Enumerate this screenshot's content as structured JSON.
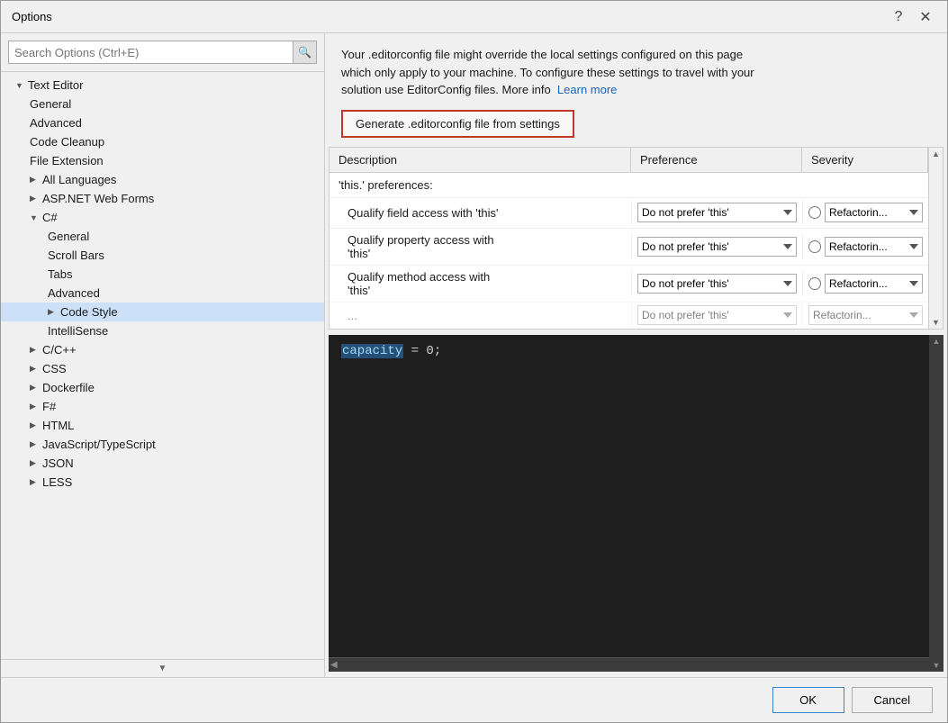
{
  "dialog": {
    "title": "Options",
    "help_btn": "?",
    "close_btn": "✕"
  },
  "search": {
    "placeholder": "Search Options (Ctrl+E)"
  },
  "tree": {
    "items": [
      {
        "id": "text-editor",
        "label": "Text Editor",
        "level": "root",
        "expanded": true,
        "indent": 16
      },
      {
        "id": "general",
        "label": "General",
        "level": "level1",
        "indent": 32
      },
      {
        "id": "advanced",
        "label": "Advanced",
        "level": "level1",
        "indent": 32
      },
      {
        "id": "code-cleanup",
        "label": "Code Cleanup",
        "level": "level1",
        "indent": 32
      },
      {
        "id": "file-extension",
        "label": "File Extension",
        "level": "level1",
        "indent": 32
      },
      {
        "id": "all-languages",
        "label": "All Languages",
        "level": "level1-expand",
        "indent": 32
      },
      {
        "id": "aspnet",
        "label": "ASP.NET Web Forms",
        "level": "level1-expand",
        "indent": 32
      },
      {
        "id": "csharp",
        "label": "C#",
        "level": "level1-open",
        "indent": 32
      },
      {
        "id": "csharp-general",
        "label": "General",
        "level": "level2",
        "indent": 48
      },
      {
        "id": "scroll-bars",
        "label": "Scroll Bars",
        "level": "level2",
        "indent": 48
      },
      {
        "id": "tabs",
        "label": "Tabs",
        "level": "level2",
        "indent": 48
      },
      {
        "id": "csharp-advanced",
        "label": "Advanced",
        "level": "level2",
        "indent": 48
      },
      {
        "id": "code-style",
        "label": "Code Style",
        "level": "level2-open",
        "indent": 48,
        "selected": true
      },
      {
        "id": "intellisense",
        "label": "IntelliSense",
        "level": "level2",
        "indent": 48
      },
      {
        "id": "cpp",
        "label": "C/C++",
        "level": "level1-expand",
        "indent": 32
      },
      {
        "id": "css",
        "label": "CSS",
        "level": "level1-expand",
        "indent": 32
      },
      {
        "id": "dockerfile",
        "label": "Dockerfile",
        "level": "level1-expand",
        "indent": 32
      },
      {
        "id": "fsharp",
        "label": "F#",
        "level": "level1-expand",
        "indent": 32
      },
      {
        "id": "html",
        "label": "HTML",
        "level": "level1-expand",
        "indent": 32
      },
      {
        "id": "javascript",
        "label": "JavaScript/TypeScript",
        "level": "level1-expand",
        "indent": 32
      },
      {
        "id": "json",
        "label": "JSON",
        "level": "level1-expand",
        "indent": 32
      },
      {
        "id": "less",
        "label": "LESS",
        "level": "level1-expand",
        "indent": 32
      }
    ]
  },
  "notice": {
    "text1": "Your .editorconfig file might override the local settings configured on this page",
    "text2": "which only apply to your machine. To configure these settings to travel with your",
    "text3": "solution use EditorConfig files. More info",
    "link": "Learn more"
  },
  "generate_btn": "Generate .editorconfig file from settings",
  "table": {
    "headers": [
      "Description",
      "Preference",
      "Severity"
    ],
    "section_label": "'this.' preferences:",
    "rows": [
      {
        "desc": "Qualify field access with 'this'",
        "pref": "Do not prefer 'this'",
        "sev": "Refactorin..."
      },
      {
        "desc": "Qualify property access with\n'this'",
        "pref": "Do not prefer 'this'",
        "sev": "Refactorin..."
      },
      {
        "desc": "Qualify method access with\n'this'",
        "pref": "Do not prefer 'this'",
        "sev": "Refactorin..."
      },
      {
        "desc": "...",
        "pref": "Do not prefer 'this'",
        "sev": "Refactorin..."
      }
    ]
  },
  "code": {
    "highlight": "capacity",
    "rest": " = 0;"
  },
  "footer": {
    "ok": "OK",
    "cancel": "Cancel"
  }
}
